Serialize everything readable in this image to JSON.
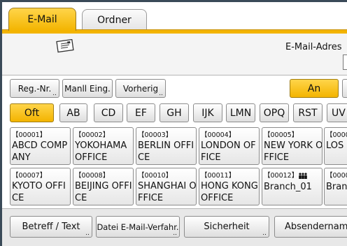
{
  "tabs": {
    "email": "E-Mail",
    "folder": "Ordner"
  },
  "header": {
    "address_label": "E-Mail-Adres"
  },
  "row1": {
    "reg_nr": "Reg.-Nr.",
    "manual": "Manll Eing.",
    "prev": "Vorherig",
    "an": "An"
  },
  "alpha": [
    "Oft",
    "AB",
    "CD",
    "EF",
    "GH",
    "IJK",
    "LMN",
    "OPQ",
    "RST",
    "UV"
  ],
  "entries": [
    {
      "num": "【00001】",
      "name": "ABCD COMPANY"
    },
    {
      "num": "【00002】",
      "name": "YOKOHAMA OFFICE"
    },
    {
      "num": "【00003】",
      "name": "BERLIN OFFICE"
    },
    {
      "num": "【00004】",
      "name": "LONDON OFFICE"
    },
    {
      "num": "【00005】",
      "name": "NEW YORK OFFICE"
    },
    {
      "num": "【0000",
      "name": "LOS"
    },
    {
      "num": "【00007】",
      "name": "KYOTO OFFICE"
    },
    {
      "num": "【00008】",
      "name": "BEIJING OFFICE"
    },
    {
      "num": "【00010】",
      "name": "SHANGHAI OFFICE"
    },
    {
      "num": "【00011】",
      "name": "HONG KONG OFFICE"
    },
    {
      "num": "【00012】",
      "name": "Branch_01"
    },
    {
      "num": "【0000",
      "name": "Bran"
    }
  ],
  "bottom": {
    "subject": "Betreff / Text",
    "file": "Datei E-Mail-Verfahr.",
    "security": "Sicherheit",
    "sender": "Absendername"
  },
  "colors": {
    "accent": "#f3b400",
    "frame": "#3a4a58"
  }
}
